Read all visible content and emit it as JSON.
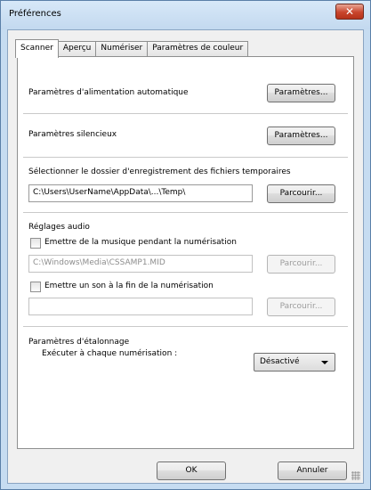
{
  "window": {
    "title": "Préférences",
    "close_label": "✕"
  },
  "tabs": [
    {
      "label": "Scanner"
    },
    {
      "label": "Aperçu"
    },
    {
      "label": "Numériser"
    },
    {
      "label": "Paramètres de couleur"
    }
  ],
  "auto_feed": {
    "label": "Paramètres d'alimentation automatique",
    "button": "Paramètres..."
  },
  "quiet": {
    "label": "Paramètres silencieux",
    "button": "Paramètres..."
  },
  "temp_folder": {
    "label": "Sélectionner le dossier d'enregistrement des fichiers temporaires",
    "value": "C:\\Users\\UserName\\AppData\\...\\Temp\\",
    "button": "Parcourir..."
  },
  "audio": {
    "heading": "Réglages audio",
    "music_checkbox_label": "Emettre de la musique pendant la numérisation",
    "music_path": "C:\\Windows\\Media\\CSSAMP1.MID",
    "music_browse": "Parcourir...",
    "sound_checkbox_label": "Emettre un son à la fin de la numérisation",
    "sound_path": "",
    "sound_browse": "Parcourir..."
  },
  "calibration": {
    "heading": "Paramètres d'étalonnage",
    "label": "Exécuter à chaque numérisation :",
    "selected": "Désactivé"
  },
  "footer": {
    "ok": "OK",
    "cancel": "Annuler"
  }
}
